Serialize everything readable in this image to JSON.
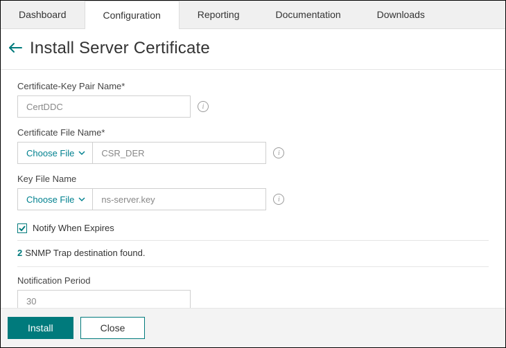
{
  "tabs": {
    "items": [
      "Dashboard",
      "Configuration",
      "Reporting",
      "Documentation",
      "Downloads"
    ],
    "activeIndex": 1
  },
  "page": {
    "title": "Install Server Certificate"
  },
  "form": {
    "certKeyPair": {
      "label": "Certificate-Key Pair Name*",
      "value": "CertDDC"
    },
    "certFile": {
      "label": "Certificate File Name*",
      "chooseLabel": "Choose File",
      "value": "CSR_DER"
    },
    "keyFile": {
      "label": "Key File Name",
      "chooseLabel": "Choose File",
      "value": "ns-server.key"
    },
    "notify": {
      "label": "Notify When Expires",
      "checked": true
    },
    "snmp": {
      "count": "2",
      "text": "SNMP Trap destination found."
    },
    "notificationPeriod": {
      "label": "Notification Period",
      "value": "30"
    }
  },
  "footer": {
    "install": "Install",
    "close": "Close"
  }
}
